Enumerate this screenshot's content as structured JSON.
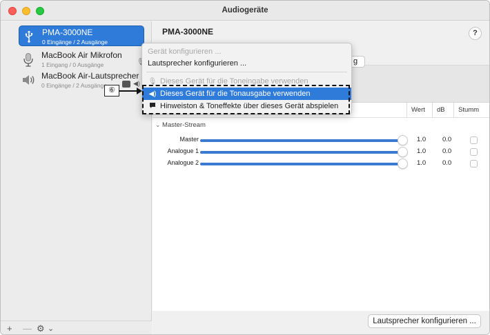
{
  "window": {
    "title": "Audiogeräte"
  },
  "sidebar": {
    "devices": [
      {
        "name": "PMA-3000NE",
        "sub": "0 Eingänge / 2 Ausgänge",
        "icon": "usb-icon",
        "selected": true
      },
      {
        "name": "MacBook Air Mikrofon",
        "sub": "1 Eingang / 0 Ausgänge",
        "icon": "microphone-icon",
        "selected": false
      },
      {
        "name": "MacBook Air-Lautsprecher",
        "sub": "0 Eingänge / 2 Ausgänge",
        "icon": "speaker-icon",
        "selected": false
      }
    ],
    "footer": {
      "add": "+",
      "remove": "—",
      "gear": "⚙",
      "chevron": "⌄"
    }
  },
  "main": {
    "title": "PMA-3000NE",
    "help": "?",
    "segment_partial": "g",
    "table": {
      "headers": {
        "wert": "Wert",
        "db": "dB",
        "stumm": "Stumm"
      },
      "group": "Master-Stream",
      "rows": [
        {
          "label": "Master",
          "value": "1.0",
          "db": "0.0",
          "level": 1.0
        },
        {
          "label": "Analogue 1",
          "value": "1.0",
          "db": "0.0",
          "level": 1.0
        },
        {
          "label": "Analogue 2",
          "value": "1.0",
          "db": "0.0",
          "level": 1.0
        }
      ]
    },
    "configure_speakers_button": "Lautsprecher konfigurieren ..."
  },
  "menu": {
    "items": [
      {
        "label": "Gerät konfigurieren ...",
        "enabled": false
      },
      {
        "label": "Lautsprecher konfigurieren ...",
        "enabled": true
      },
      {
        "label": "Dieses Gerät für die Toneingabe verwenden",
        "enabled": false,
        "icon": "microphone-icon"
      },
      {
        "label": "Dieses Gerät für die Tonausgabe verwenden",
        "enabled": true,
        "highlighted": true,
        "icon": "speaker-icon"
      },
      {
        "label": "Hinweiston & Toneffekte über dieses Gerät abspielen",
        "enabled": true,
        "icon": "speech-bubble-icon"
      }
    ]
  },
  "callout": {
    "number": "⑥"
  },
  "colors": {
    "accent": "#2f7bd9",
    "slider": "#3a7ad3"
  }
}
